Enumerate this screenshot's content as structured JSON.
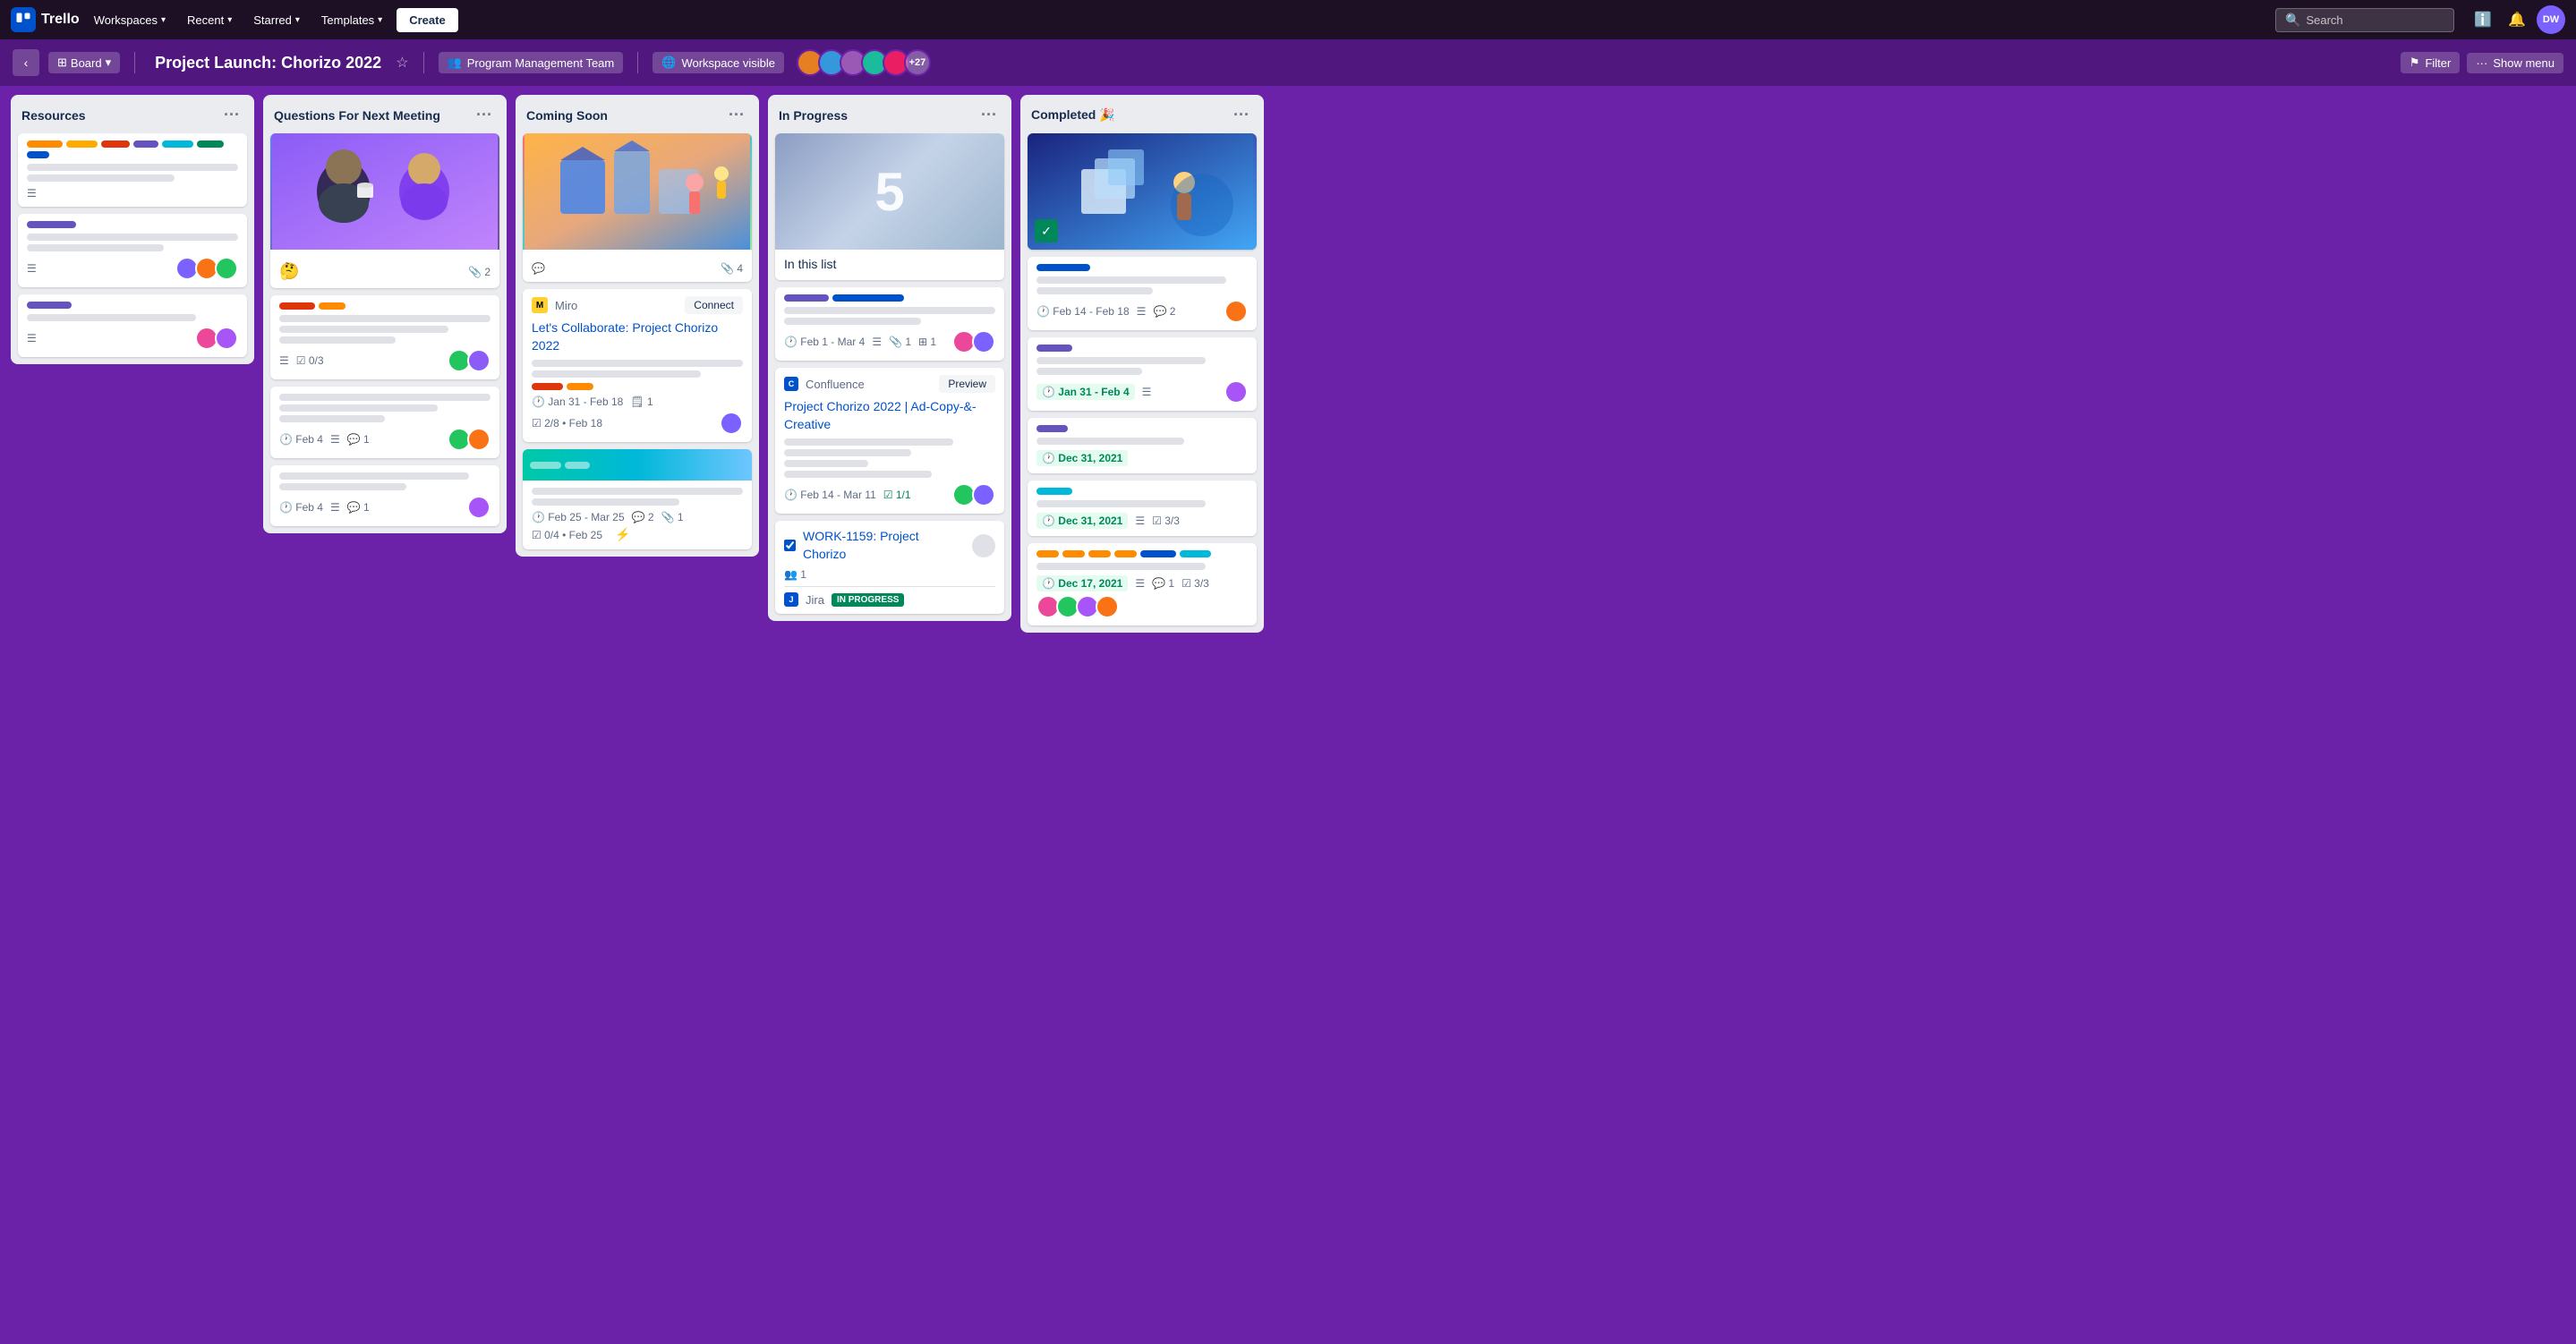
{
  "app": {
    "logo_text": "Trello",
    "nav": {
      "workspaces_label": "Workspaces",
      "recent_label": "Recent",
      "starred_label": "Starred",
      "templates_label": "Templates",
      "create_label": "Create",
      "search_placeholder": "Search",
      "info_icon": "ℹ",
      "notification_icon": "🔔",
      "user_initials": "DW"
    },
    "board_header": {
      "back_icon": "‹",
      "view_label": "Board",
      "title": "Project Launch: Chorizo 2022",
      "star_icon": "☆",
      "team_icon": "👥",
      "team_label": "Program Management Team",
      "workspace_icon": "🌐",
      "workspace_label": "Workspace visible",
      "members_more": "+27",
      "filter_icon": "⚑",
      "filter_label": "Filter",
      "menu_icon": "···",
      "menu_label": "Show menu"
    },
    "columns": [
      {
        "id": "resources",
        "title": "Resources",
        "cards": [
          {
            "id": "r1",
            "type": "labels_only",
            "labels": [
              {
                "color": "#FF8B00",
                "width": 40
              },
              {
                "color": "#FFAB00",
                "width": 35
              },
              {
                "color": "#DE350B",
                "width": 32
              },
              {
                "color": "#6554C0",
                "width": 28
              },
              {
                "color": "#00B8D9",
                "width": 35
              }
            ],
            "has_desc": true,
            "desc_lines": [
              1,
              0.6
            ]
          },
          {
            "id": "r2",
            "type": "normal",
            "title_lines": [
              1,
              0.6
            ],
            "has_desc": true,
            "avatars": [
              "#7B61FF",
              "#F97316",
              "#22C55E"
            ]
          },
          {
            "id": "r3",
            "type": "normal",
            "title_lines": [
              0.7,
              0.4
            ],
            "has_desc": true,
            "avatars": [
              "#EC4899",
              "#A855F7"
            ]
          }
        ]
      },
      {
        "id": "questions",
        "title": "Questions For Next Meeting",
        "cards": [
          {
            "id": "q1",
            "type": "cover_image",
            "cover_type": "people",
            "emoji": "🤔",
            "attachments": 2
          },
          {
            "id": "q2",
            "type": "normal",
            "labels": [
              {
                "color": "#DE350B",
                "width": 40
              },
              {
                "color": "#FF8B00",
                "width": 30
              }
            ],
            "desc_lines": [
              1,
              0.7,
              0.5
            ],
            "checklist": "0/3",
            "avatars": [
              "#22C55E",
              "#8B5CF6"
            ]
          },
          {
            "id": "q3",
            "type": "normal",
            "desc_lines": [
              1,
              0.7,
              0.5
            ],
            "date": "Feb 4",
            "comments": 1,
            "avatars": [
              "#22C55E",
              "#F97316"
            ]
          },
          {
            "id": "q4",
            "type": "normal",
            "desc_lines": [
              0.9,
              0.6
            ],
            "date": "Feb 4",
            "comments": 1,
            "avatars": [
              "#A855F7"
            ]
          }
        ]
      },
      {
        "id": "coming_soon",
        "title": "Coming Soon",
        "cards": [
          {
            "id": "cs1",
            "type": "cover_image",
            "cover_type": "illustration",
            "comment_icon": true,
            "attachments": 4
          },
          {
            "id": "cs2",
            "type": "miro_link",
            "title": "Let's Collaborate: Project Chorizo 2022",
            "miro_label": "Miro",
            "connect_btn": "Connect",
            "desc_lines": [
              1,
              0.8,
              0.6
            ],
            "labels": [
              {
                "color": "#DE350B",
                "width": 35
              },
              {
                "color": "#FF8B00",
                "width": 30
              }
            ],
            "date_range": "Jan 31 - Feb 18",
            "tasks": 1,
            "subtask": "2/8 • Feb 18",
            "avatar": "#7B61FF"
          },
          {
            "id": "cs3",
            "type": "cover_image",
            "cover_type": "green_gradient",
            "desc_lines": [
              1,
              0.7
            ],
            "date_range": "Feb 25 - Mar 25",
            "comments": 2,
            "attachments": 1,
            "subtask": "0/4 • Feb 25"
          }
        ]
      },
      {
        "id": "in_progress",
        "title": "In Progress",
        "cards": [
          {
            "id": "ip1",
            "type": "big_cover",
            "big_number": "5",
            "big_subtitle": "In this list"
          },
          {
            "id": "ip2",
            "type": "normal",
            "labels": [
              {
                "color": "#6554C0",
                "width": 50
              },
              {
                "color": "#0052CC",
                "width": 80
              }
            ],
            "desc_lines": [
              1,
              0.6
            ],
            "date_range": "Feb 1 - Mar 4",
            "description_icon": true,
            "attachments": 1,
            "tasks": 1,
            "avatars": [
              "#EC4899",
              "#7B61FF"
            ]
          },
          {
            "id": "ip3",
            "type": "confluence_card",
            "title": "Project Chorizo 2022 | Ad-Copy-&-Creative",
            "confluence_label": "Confluence",
            "preview_btn": "Preview",
            "desc_lines": [
              0.8,
              0.6,
              0.4,
              0.7
            ],
            "date_range": "Feb 14 - Mar 11",
            "checklist": "1/1",
            "avatars": [
              "#22C55E",
              "#7B61FF"
            ]
          },
          {
            "id": "ip4",
            "type": "jira_card",
            "title": "WORK-1159: Project Chorizo",
            "members": 1,
            "jira_status": "IN PROGRESS",
            "jira_label": "Jira"
          }
        ]
      },
      {
        "id": "completed",
        "title": "Completed 🎉",
        "cards": [
          {
            "id": "c1",
            "type": "cover_image",
            "cover_type": "blue_scene",
            "checkmark": true
          },
          {
            "id": "c2",
            "type": "normal",
            "desc_lines": [
              0.9,
              0.5
            ],
            "date_range": "Feb 14 - Feb 18",
            "comments": 2,
            "description_icon": true,
            "avatars": [
              "#F97316"
            ]
          },
          {
            "id": "c3",
            "type": "normal",
            "labels": [
              {
                "color": "#6554C0",
                "width": 40
              }
            ],
            "desc_lines": [
              0.8,
              0.5
            ],
            "date_green": "Jan 31 - Feb 4",
            "description_icon": true,
            "avatars": [
              "#A855F7"
            ]
          },
          {
            "id": "c4",
            "type": "normal",
            "labels": [
              {
                "color": "#6554C0",
                "width": 35
              }
            ],
            "desc_lines": [
              0.7
            ],
            "date_green": "Dec 31, 2021",
            "avatars": []
          },
          {
            "id": "c5",
            "type": "normal",
            "labels": [
              {
                "color": "#00B8D9",
                "width": 40
              }
            ],
            "desc_lines": [
              0.8
            ],
            "date_green": "Dec 31, 2021",
            "description_icon": true,
            "checklist": "3/3",
            "avatars": []
          },
          {
            "id": "c6",
            "type": "normal",
            "labels": [
              {
                "color": "#FF8B00",
                "width": 28
              },
              {
                "color": "#FF8B00",
                "width": 28
              },
              {
                "color": "#FF8B00",
                "width": 28
              },
              {
                "color": "#FF8B00",
                "width": 28
              },
              {
                "color": "#0052CC",
                "width": 40
              },
              {
                "color": "#00B8D9",
                "width": 35
              }
            ],
            "desc_lines": [
              0.8
            ],
            "date_green": "Dec 17, 2021",
            "comments": 1,
            "description_icon": true,
            "checklist": "3/3",
            "avatars": [
              "#EC4899",
              "#22C55E",
              "#A855F7",
              "#F97316"
            ]
          }
        ]
      }
    ]
  }
}
